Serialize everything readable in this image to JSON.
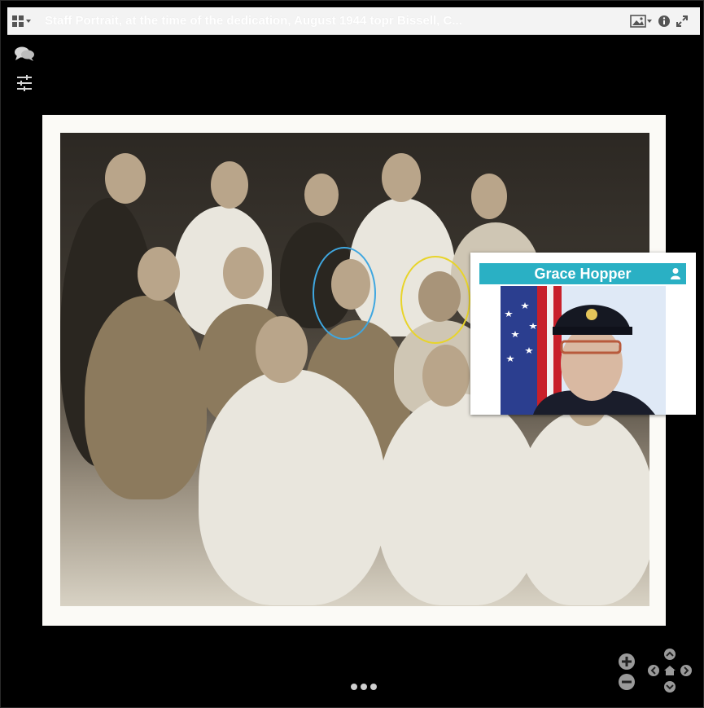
{
  "window": {
    "title": "Staff Portrait, at the time of the dedication, August 1944 topr Bissell, C..."
  },
  "toolbar": {
    "layout_icon": "grid-icon",
    "image_menu_icon": "image-icon",
    "info_icon": "info-icon",
    "fullscreen_icon": "expand-icon"
  },
  "side_tools": [
    {
      "icon": "comments-icon"
    },
    {
      "icon": "sliders-icon"
    }
  ],
  "popup": {
    "name": "Grace Hopper",
    "icon": "user-icon"
  },
  "face_tags": [
    {
      "color": "#3fa7e0"
    },
    {
      "color": "#e8d42a"
    }
  ],
  "navigation": {
    "zoom_in_icon": "plus-icon",
    "zoom_out_icon": "minus-icon",
    "up_icon": "chevron-up-icon",
    "down_icon": "chevron-down-icon",
    "left_icon": "chevron-left-icon",
    "right_icon": "chevron-right-icon",
    "home_icon": "home-icon"
  },
  "colors": {
    "popup_header": "#2ab0c4",
    "tag_blue": "#3fa7e0",
    "tag_yellow": "#e8d42a"
  }
}
